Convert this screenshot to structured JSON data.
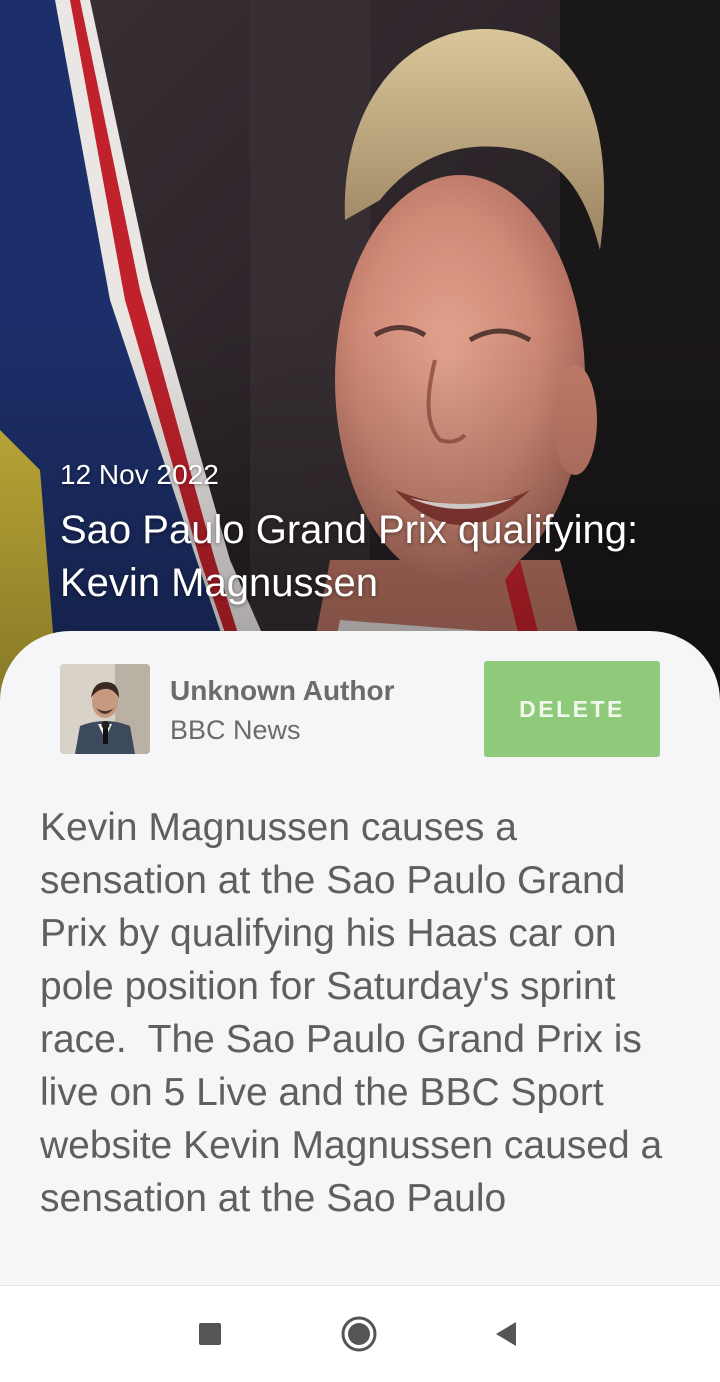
{
  "article": {
    "date": "12 Nov 2022",
    "title": "Sao Paulo Grand Prix qualifying: Kevin Magnussen",
    "author": "Unknown Author",
    "source": "BBC News",
    "delete_label": "DELETE",
    "body": "Kevin Magnussen causes a sensation at the Sao Paulo Grand Prix by qualifying his Haas car on pole position for Saturday's sprint race.  The Sao Paulo Grand Prix is live on 5 Live and the BBC Sport website Kevin Magnussen caused a sensation at the Sao Paulo"
  },
  "icons": {
    "hero": "driver-photo",
    "avatar": "author-avatar",
    "recents": "square-icon",
    "home": "circle-home-icon",
    "back": "triangle-back-icon"
  },
  "colors": {
    "delete_button": "#8fca7b",
    "sheet_background": "#f6f6f8"
  }
}
